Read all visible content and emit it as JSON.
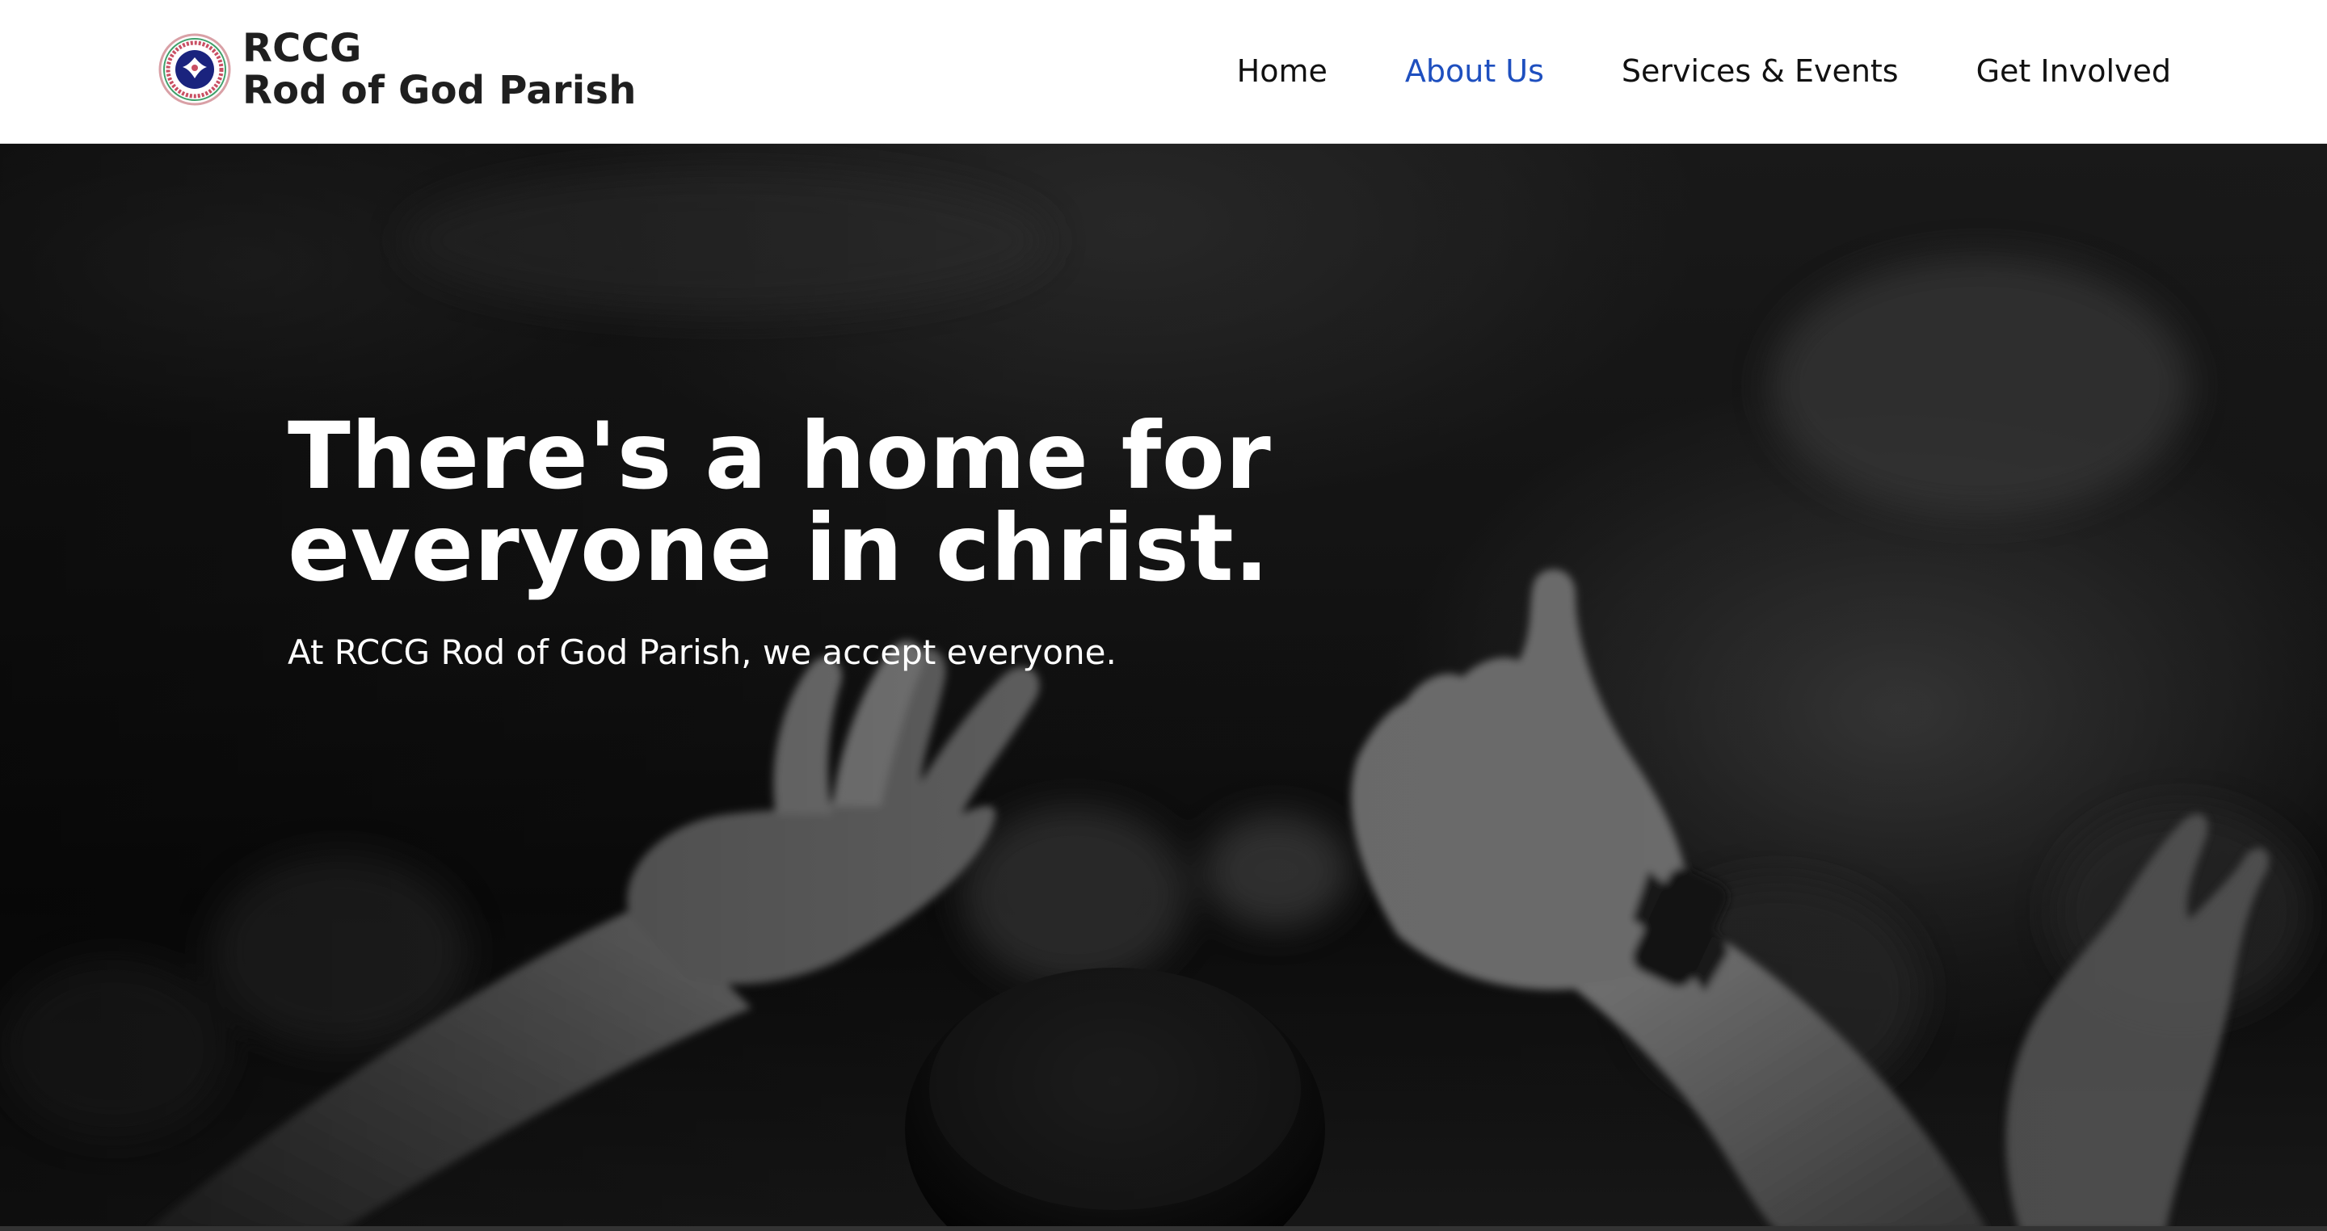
{
  "brand": {
    "line1": "RCCG",
    "line2": "Rod of God Parish",
    "logo_icon": "rccg-logo-icon"
  },
  "nav": {
    "items": [
      {
        "label": "Home",
        "active": false
      },
      {
        "label": "About Us",
        "active": true
      },
      {
        "label": "Services & Events",
        "active": false
      },
      {
        "label": "Get Involved",
        "active": false
      }
    ]
  },
  "hero": {
    "title_line1": "There's a home for",
    "title_line2": "everyone in christ.",
    "subtitle": "At RCCG Rod of God Parish, we accept everyone.",
    "background_image": "black-and-white photo of raised hands in worship"
  },
  "colors": {
    "nav_active": "#1e4fbf",
    "text_dark": "#111111",
    "hero_text": "#ffffff"
  }
}
